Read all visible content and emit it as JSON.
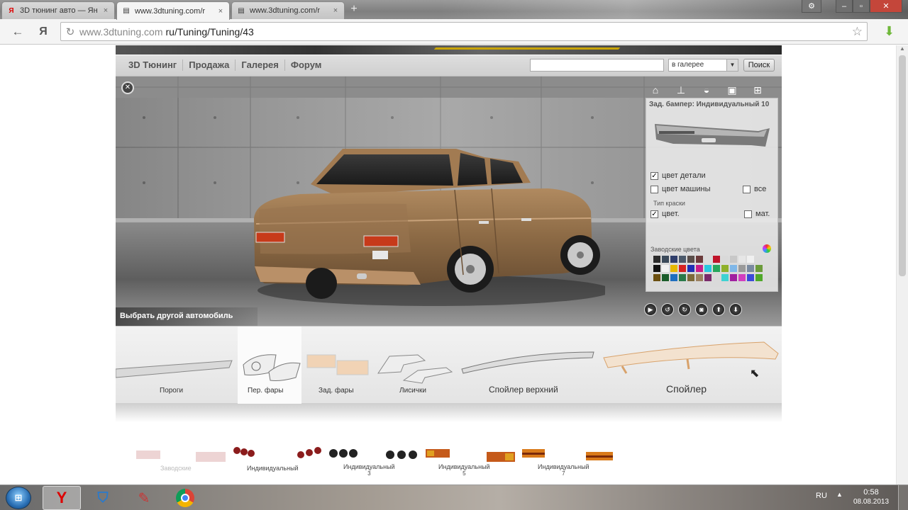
{
  "browser": {
    "tabs": [
      {
        "label": "3D тюнинг авто — Ян",
        "favicon": "Я"
      },
      {
        "label": "www.3dtuning.com/r",
        "favicon": "doc"
      },
      {
        "label": "www.3dtuning.com/r",
        "favicon": "doc"
      }
    ],
    "new_tab": "+",
    "address": {
      "host": "www.3dtuning.com",
      "path": "ru/Tuning/Tuning/43"
    },
    "back_icon": "←",
    "yandex_icon": "Я",
    "reload_icon": "↻",
    "star_icon": "☆",
    "extension_icon": "⬇"
  },
  "site": {
    "menu": [
      "3D Тюнинг",
      "Продажа",
      "Галерея",
      "Форум"
    ],
    "search": {
      "value": "",
      "scope": "в галерее",
      "button": "Поиск"
    },
    "choose_car": "Выбрать другой автомобиль",
    "panel": {
      "title": "Зад. бампер: Индивидуальный 10",
      "part_color": "цвет детали",
      "car_color": "цвет машины",
      "all": "все",
      "paint_type": "Тип краски",
      "paint_color": "цвет.",
      "matte": "мат.",
      "factory_colors": "Заводские цвета",
      "swatches": [
        "#2b2b2b",
        "#3b4a5a",
        "#2f3e6b",
        "#4c5a6b",
        "#5a4e4a",
        "#6b3a3a",
        "",
        "#c0142a",
        "#d9d9d9",
        "#c8c8c8",
        "#e6e6e6",
        "#f0f0f0",
        "",
        "",
        "#111111",
        "#f2f2f2",
        "#e6b800",
        "#d62222",
        "#1f2fb5",
        "#c81c8a",
        "#29c7e0",
        "#26a65b",
        "#8fb02a",
        "#7fb7e8",
        "#9a9a9a",
        "#7a8aa0",
        "#6b9b3a",
        "",
        "#6b4f0f",
        "#1a5c2a",
        "#1f6fbf",
        "#2a7a4a",
        "#7d6a3a",
        "#9c8060",
        "#7a2a6b",
        "",
        "#3fd2d2",
        "#a020a0",
        "#d23fbf",
        "#3b4ad9",
        "#4fa82a",
        ""
      ]
    },
    "parts": [
      {
        "label": "Пороги"
      },
      {
        "label": "Пер. фары"
      },
      {
        "label": "Зад. фары"
      },
      {
        "label": "Лисички"
      },
      {
        "label": "Спойлер верхний"
      },
      {
        "label": "Спойлер"
      }
    ],
    "variants": [
      {
        "label": "Заводские"
      },
      {
        "label": "Индивидуальный",
        "sub": ""
      },
      {
        "label": "Индивидуальный",
        "sub": "3"
      },
      {
        "label": "Индивидуальный",
        "sub": "5"
      },
      {
        "label": "Индивидуальный",
        "sub": "7"
      }
    ]
  },
  "taskbar": {
    "start": "⊞",
    "lang": "RU",
    "tray_arrow": "▲",
    "time": "0:58",
    "date": "08.08.2013"
  }
}
